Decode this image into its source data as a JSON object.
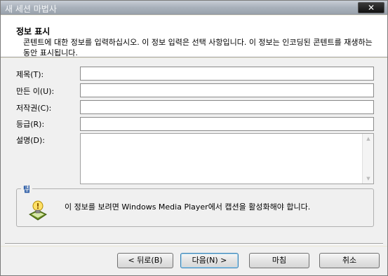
{
  "window": {
    "title": "새 세션 마법사",
    "close_label": "✕"
  },
  "header": {
    "title": "정보 표시",
    "description": "콘텐트에 대한 정보를 입력하십시오. 이 정보 입력은 선택 사항입니다. 이 정보는 인코딩된 콘텐트를 재생하는 동안 표시됩니다."
  },
  "fields": {
    "title_label": "제목(T):",
    "author_label": "만든 이(U):",
    "copyright_label": "저작권(C):",
    "rating_label": "등급(R):",
    "description_label": "설명(D):",
    "title_value": "",
    "author_value": "",
    "copyright_value": "",
    "rating_value": "",
    "description_value": ""
  },
  "tip": {
    "legend": "팁",
    "text": "이 정보를 보려면 Windows Media Player에서 캡션을 활성화해야 합니다.",
    "icon": "lightbulb-icon"
  },
  "buttons": {
    "back": "< 뒤로(B)",
    "next": "다음(N) >",
    "finish": "마침",
    "cancel": "취소"
  }
}
